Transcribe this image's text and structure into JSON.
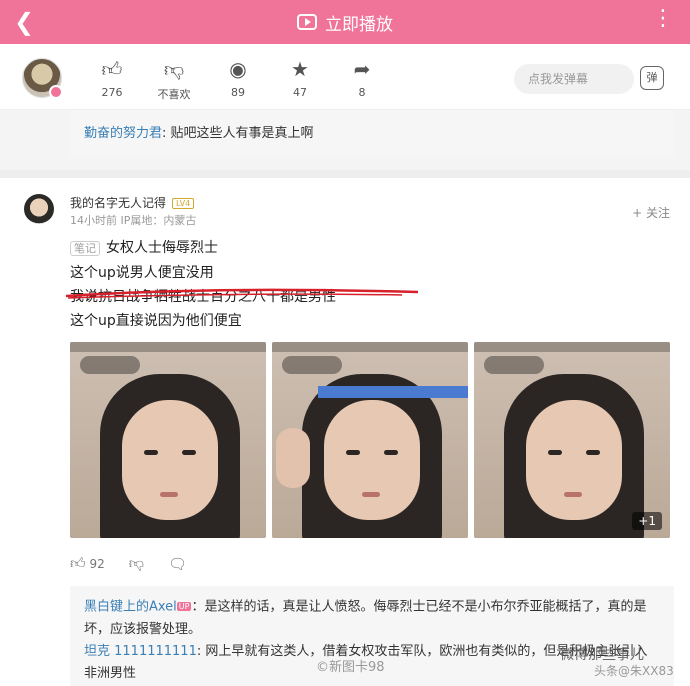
{
  "header": {
    "title": "立即播放",
    "back_icon": "chevron-left-icon",
    "more_icon": "more-vertical-icon",
    "bg_color": "#f0739a"
  },
  "actions": {
    "like": {
      "icon": "thumb-up-icon",
      "count": "276"
    },
    "dislike": {
      "icon": "thumb-down-icon",
      "label": "不喜欢"
    },
    "coin": {
      "icon": "coin-icon",
      "count": "89"
    },
    "favorite": {
      "icon": "star-icon",
      "count": "47"
    },
    "share": {
      "icon": "share-icon",
      "count": "8"
    },
    "danmaku_placeholder": "点我发弹幕",
    "danmaku_button": "弹"
  },
  "quote_top": {
    "username": "勤奋的努力君",
    "text": ": 贴吧这些人有事是真上啊"
  },
  "comment": {
    "username": "我的名字无人记得",
    "level": "LV4",
    "time": "14小时前",
    "ip": "IP属地：内蒙古",
    "follow": "+ 关注",
    "note_tag": "笔记",
    "lines": [
      "女权人士侮辱烈士",
      "这个up说男人便宜没用",
      "我说抗日战争牺牲战士百分之八十都是男性",
      "这个up直接说因为他们便宜"
    ],
    "image_more": "+1",
    "likes": "92",
    "reply_icon": "comment-icon"
  },
  "replies": [
    {
      "username": "黑白键上的Axel",
      "tag": "UP",
      "text": "：是这样的话，真是让人愤怒。侮辱烈士已经不是小布尔乔亚能概括了，真的是坏，应该报警处理。"
    },
    {
      "username": "坦克 1111111111",
      "text": ": 网上早就有这类人，借着女权攻击军队，欧洲也有类似的，但是积极主张引入非洲男性"
    }
  ],
  "watermarks": {
    "center": "©新图卡98",
    "right_top": "微博那些事儿",
    "right_bottom": "头条@朱XX83"
  }
}
